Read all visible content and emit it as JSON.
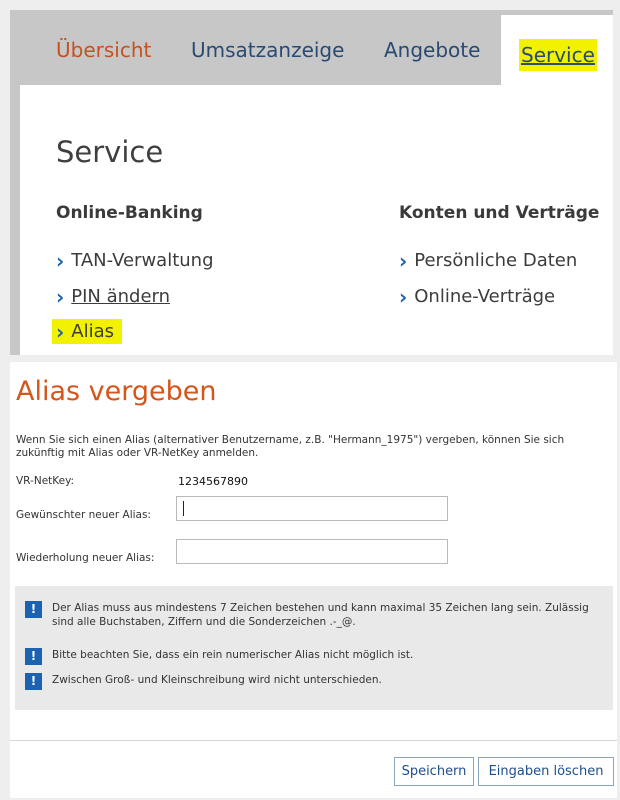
{
  "nav": {
    "items": [
      "Übersicht",
      "Umsatzanzeige",
      "Angebote"
    ],
    "active": "Service"
  },
  "service": {
    "title": "Service",
    "online_banking": {
      "heading": "Online-Banking",
      "links": [
        "TAN-Verwaltung",
        "PIN ändern",
        "Alias"
      ]
    },
    "konten": {
      "heading": "Konten und Verträge",
      "links": [
        "Persönliche Daten",
        "Online-Verträge"
      ]
    }
  },
  "alias_form": {
    "title": "Alias vergeben",
    "intro": "Wenn Sie sich einen Alias (alternativer Benutzername, z.B. \"Hermann_1975\") vergeben, können Sie sich zukünftig mit Alias oder VR-NetKey anmelden.",
    "netkey_label": "VR-NetKey:",
    "netkey_value": "1234567890",
    "new_alias_label": "Gewünschter neuer Alias:",
    "new_alias_value": "",
    "repeat_alias_label": "Wiederholung neuer Alias:",
    "repeat_alias_value": "",
    "info": [
      "Der Alias muss aus mindestens 7 Zeichen bestehen und kann maximal 35 Zeichen lang sein. Zulässig sind alle Buchstaben, Ziffern und die Sonderzeichen .-_@.",
      "Bitte beachten Sie, dass ein rein numerischer Alias nicht möglich ist.",
      "Zwischen Groß- und Kleinschreibung wird nicht unterschieden."
    ],
    "save_label": "Speichern",
    "clear_label": "Eingaben löschen"
  },
  "colors": {
    "accent_orange": "#d4561b",
    "link_blue": "#1b62b0",
    "highlight": "#f2f200"
  }
}
